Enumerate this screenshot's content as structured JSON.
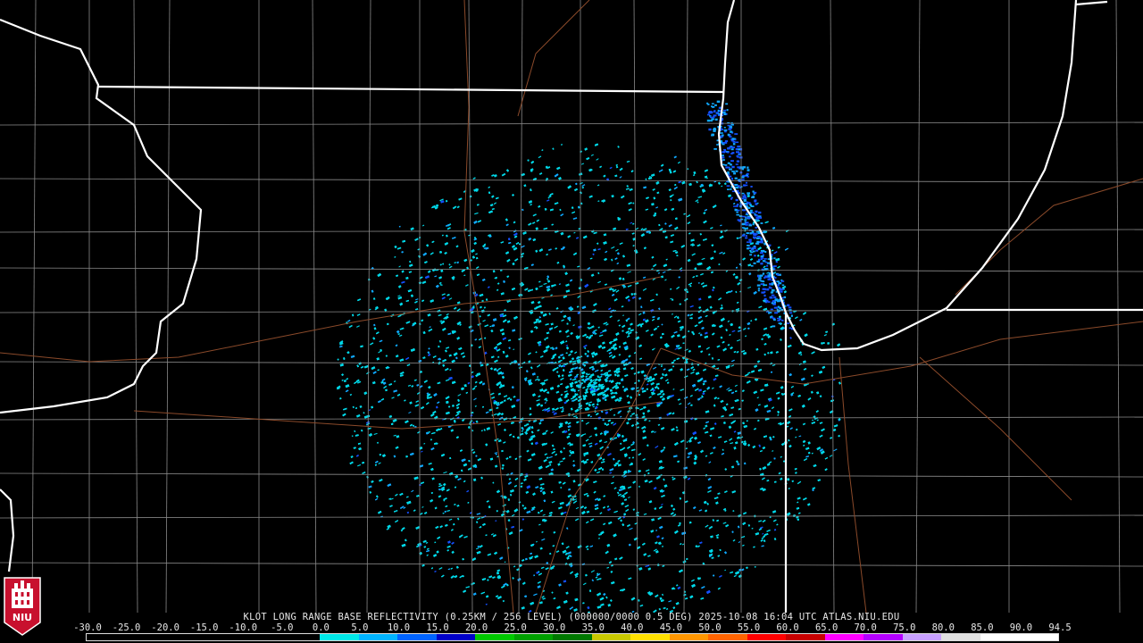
{
  "product_caption": "KLOT LONG RANGE BASE REFLECTIVITY (0.25KM / 256 LEVEL) (000000/0000 0.5 DEG) 2025-10-08 16:04 UTC  ATLAS.NIU.EDU",
  "logo_text": "NIU",
  "colorbar": {
    "ticks": [
      "-30.0",
      "-25.0",
      "-20.0",
      "-15.0",
      "-10.0",
      "-5.0",
      "0.0",
      "5.0",
      "10.0",
      "15.0",
      "20.0",
      "25.0",
      "30.0",
      "35.0",
      "40.0",
      "45.0",
      "50.0",
      "55.0",
      "60.0",
      "65.0",
      "70.0",
      "75.0",
      "80.0",
      "85.0",
      "90.0",
      "94.5"
    ],
    "colors": [
      "#000000",
      "#000000",
      "#000000",
      "#000000",
      "#000000",
      "#000000",
      "#00e8e8",
      "#00b4ff",
      "#0064ff",
      "#0000c8",
      "#00c800",
      "#00a000",
      "#007800",
      "#c8c800",
      "#ffe000",
      "#ff9600",
      "#ff6400",
      "#ff0000",
      "#c80000",
      "#ff00ff",
      "#b400ff",
      "#c8a0ff",
      "#e0e0e0",
      "#ffffff",
      "#ffffff"
    ]
  },
  "colors": {
    "background": "#000000",
    "state_border": "#ffffff",
    "county_border": "#8a8a8a",
    "highway": "#8b4a2a",
    "echo_light": "#00d8e8",
    "echo_mid": "#10a8ff",
    "echo_strong": "#1450ff",
    "logo_red": "#c8102e"
  }
}
